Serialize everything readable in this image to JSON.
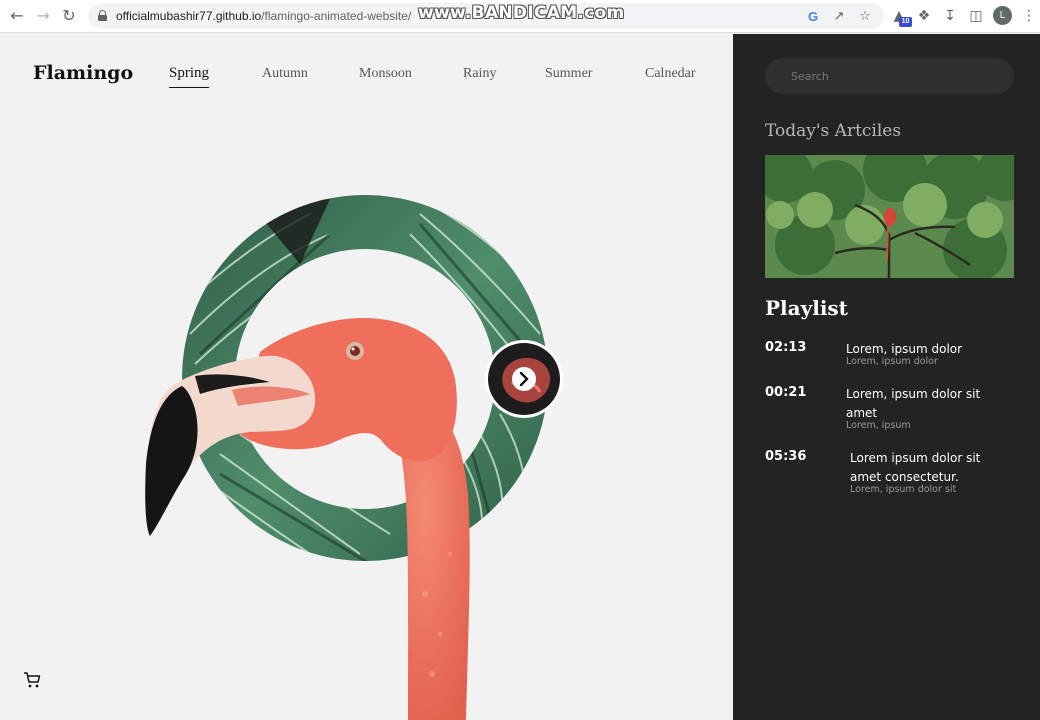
{
  "browser": {
    "back_icon": "arrow-left-icon",
    "forward_icon": "arrow-right-icon",
    "reload_icon": "reload-icon",
    "url_domain": "officialmubashir77.github.io",
    "url_path": "/flamingo-animated-website/",
    "watermark": "www.BANDICAM.com",
    "extension_badge": "10",
    "profile_initial": "L"
  },
  "site": {
    "logo": "Flamingo",
    "nav": [
      {
        "label": "Spring",
        "active": true
      },
      {
        "label": "Autumn"
      },
      {
        "label": "Monsoon"
      },
      {
        "label": "Rainy"
      },
      {
        "label": "Summer"
      },
      {
        "label": "Calnedar"
      }
    ],
    "cart_icon": "cart-icon",
    "next_icon": "chevron-right-icon"
  },
  "sidebar": {
    "search_placeholder": "Search",
    "todays_title": "Today's Artciles",
    "playlist_title": "Playlist",
    "tracks": [
      {
        "time": "02:13",
        "title": "Lorem, ipsum dolor",
        "sub": "Lorem, ipsum dolor"
      },
      {
        "time": "00:21",
        "title": "Lorem, ipsum dolor sit amet",
        "sub": "Lorem, ipsum"
      },
      {
        "time": "05:36",
        "title": "Lorem ipsum dolor sit amet consectetur.",
        "sub": "Lorem, ipsum dolor sit"
      }
    ]
  },
  "colors": {
    "sidebar_bg": "#232323",
    "page_bg": "#f2f2f2",
    "flamingo": "#ef6e5c",
    "leaf": "#3f7a5a"
  }
}
